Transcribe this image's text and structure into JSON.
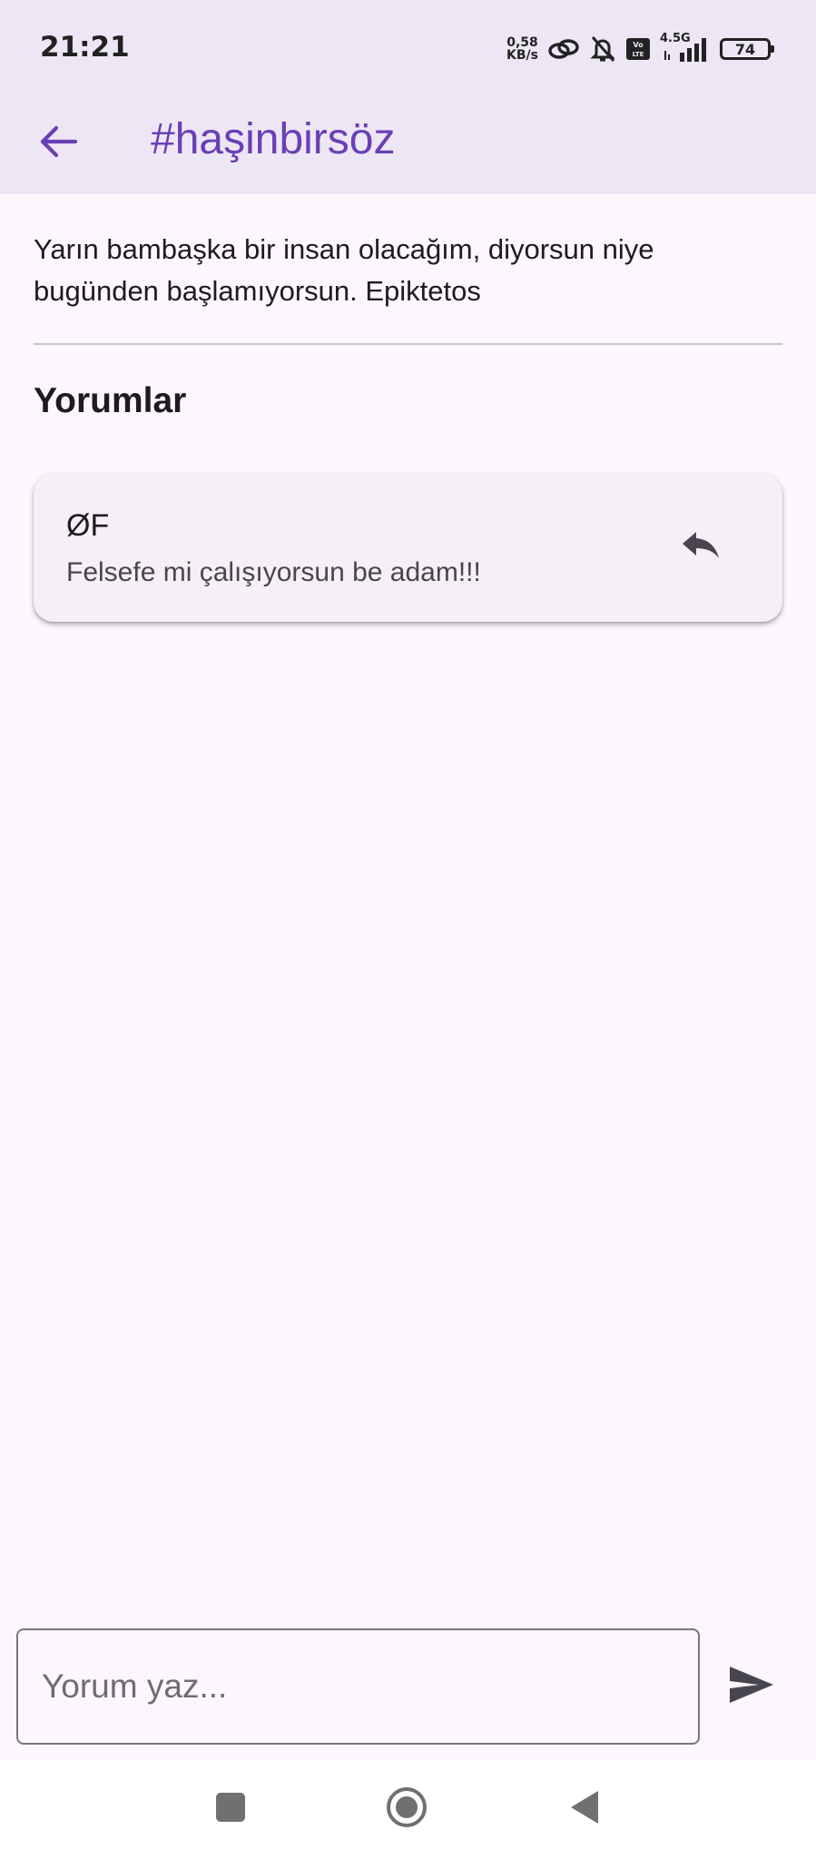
{
  "status_bar": {
    "time": "21:21",
    "net_speed_value": "0,58",
    "net_speed_unit": "KB/s",
    "network_type": "4.5G",
    "volte": "Vo LTE",
    "battery_level": "74",
    "icons": [
      "link-icon",
      "bell-off-icon",
      "volte-icon",
      "signal-icon",
      "battery-icon"
    ]
  },
  "app_bar": {
    "title": "#haşinbirsöz",
    "back_icon": "arrow-left-icon"
  },
  "post": {
    "text": "Yarın bambaşka bir insan olacağım, diyorsun niye bugünden başlamıyorsun. Epiktetos"
  },
  "comments_section": {
    "title": "Yorumlar",
    "comments": [
      {
        "author": "ØF",
        "text": "Felsefe mi çalışıyorsun be adam!!!",
        "action_icon": "reply-icon"
      }
    ]
  },
  "composer": {
    "placeholder": "Yorum yaz...",
    "value": "",
    "send_icon": "send-icon"
  },
  "nav_bar": {
    "icons": [
      "recents-icon",
      "home-icon",
      "back-icon"
    ]
  },
  "colors": {
    "accent": "#6a3fb5",
    "app_bar_bg": "#ede7f5",
    "page_bg": "#fcf6fd",
    "card_bg": "#f6eff7"
  }
}
